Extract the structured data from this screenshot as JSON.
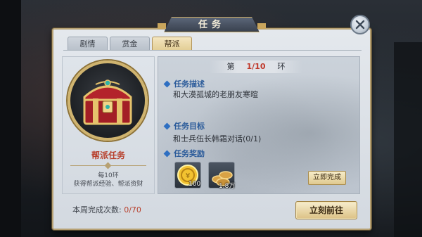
{
  "window": {
    "title": "任务"
  },
  "tabs": [
    {
      "label": "剧情",
      "active": false
    },
    {
      "label": "赏金",
      "active": false
    },
    {
      "label": "帮派",
      "active": true
    }
  ],
  "left_panel": {
    "task_name": "帮派任务",
    "frequency": "每10环",
    "reward_summary": "获得帮派经验、帮派资财"
  },
  "round": {
    "prefix": "第",
    "current": "1/10",
    "suffix": "环"
  },
  "description": {
    "heading": "任务描述",
    "text": "和大漠孤城的老朋友寒暄"
  },
  "objective": {
    "heading": "任务目标",
    "text": "和士兵伍长韩霜对话(0/1)"
  },
  "rewards": {
    "heading": "任务奖励",
    "items": [
      {
        "icon": "gold-coin-icon",
        "quantity": "100"
      },
      {
        "icon": "silver-ingots-icon",
        "quantity": "1.8万"
      }
    ]
  },
  "buttons": {
    "complete_now": "立即完成",
    "go_now": "立刻前往"
  },
  "weekly": {
    "label": "本周完成次数:",
    "count": "0/70"
  },
  "colors": {
    "accent_gold": "#c9a55c",
    "heading_blue": "#2b5b9a",
    "highlight_red": "#c0392b"
  }
}
